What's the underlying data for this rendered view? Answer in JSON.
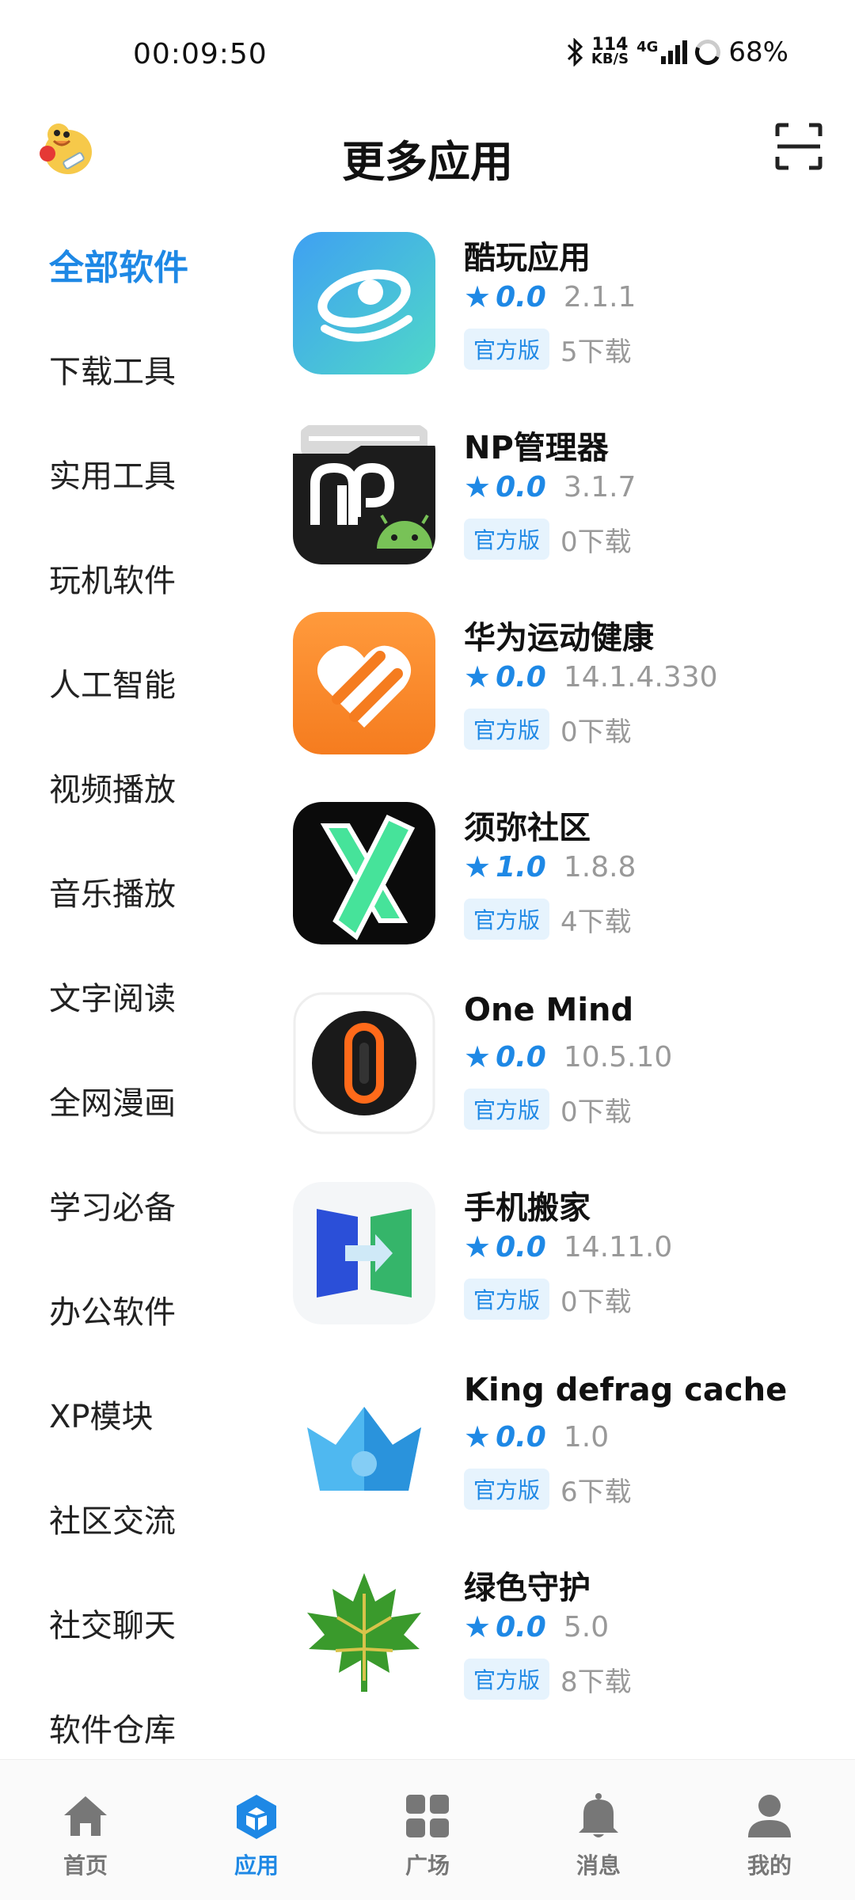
{
  "status_bar": {
    "time": "00:09:50",
    "net_speed": "114",
    "net_unit": "KB/S",
    "network": "4G",
    "battery": "68%"
  },
  "header": {
    "title": "更多应用"
  },
  "sidebar": {
    "items": [
      {
        "label": "全部软件",
        "active": true
      },
      {
        "label": "下载工具"
      },
      {
        "label": "实用工具"
      },
      {
        "label": "玩机软件"
      },
      {
        "label": "人工智能"
      },
      {
        "label": "视频播放"
      },
      {
        "label": "音乐播放"
      },
      {
        "label": "文字阅读"
      },
      {
        "label": "全网漫画"
      },
      {
        "label": "学习必备"
      },
      {
        "label": "办公软件"
      },
      {
        "label": "XP模块"
      },
      {
        "label": "社区交流"
      },
      {
        "label": "社交聊天"
      },
      {
        "label": "软件仓库"
      }
    ]
  },
  "apps": [
    {
      "name": "酷玩应用",
      "rating": "0.0",
      "version": "2.1.1",
      "tag": "官方版",
      "downloads": "5下载",
      "icon": "kuwan-icon"
    },
    {
      "name": "NP管理器",
      "rating": "0.0",
      "version": "3.1.7",
      "tag": "官方版",
      "downloads": "0下载",
      "icon": "np-manager-icon"
    },
    {
      "name": "华为运动健康",
      "rating": "0.0",
      "version": "14.1.4.330",
      "tag": "官方版",
      "downloads": "0下载",
      "icon": "huawei-health-icon"
    },
    {
      "name": "须弥社区",
      "rating": "1.0",
      "version": "1.8.8",
      "tag": "官方版",
      "downloads": "4下载",
      "icon": "xumi-icon"
    },
    {
      "name": "One Mind",
      "rating": "0.0",
      "version": "10.5.10",
      "tag": "官方版",
      "downloads": "0下载",
      "icon": "one-mind-icon"
    },
    {
      "name": "手机搬家",
      "rating": "0.0",
      "version": "14.11.0",
      "tag": "官方版",
      "downloads": "0下载",
      "icon": "phone-clone-icon"
    },
    {
      "name": "King defrag cache",
      "rating": "0.0",
      "version": "1.0",
      "tag": "官方版",
      "downloads": "6下载",
      "icon": "crown-icon"
    },
    {
      "name": "绿色守护",
      "rating": "0.0",
      "version": "5.0",
      "tag": "官方版",
      "downloads": "8下载",
      "icon": "maple-leaf-icon"
    }
  ],
  "bottom_nav": [
    {
      "label": "首页",
      "icon": "home-icon"
    },
    {
      "label": "应用",
      "icon": "cube-icon",
      "active": true
    },
    {
      "label": "广场",
      "icon": "grid-icon"
    },
    {
      "label": "消息",
      "icon": "bell-icon"
    },
    {
      "label": "我的",
      "icon": "user-icon"
    }
  ],
  "colors": {
    "accent": "#1e88e5",
    "sidebar_active_bg": "#bfe3fb",
    "tag_bg": "#e6f3fd"
  }
}
